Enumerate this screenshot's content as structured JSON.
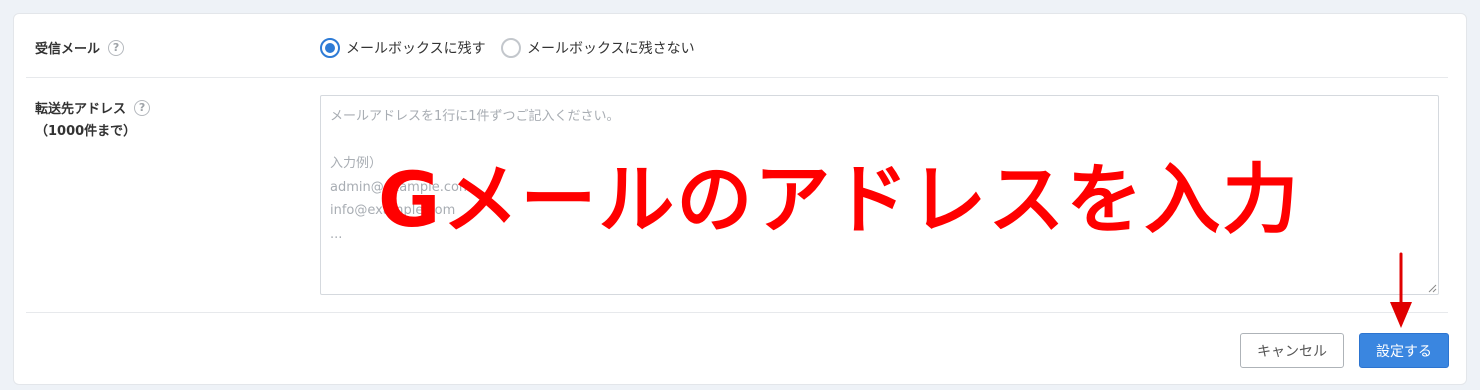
{
  "form": {
    "receive_mail": {
      "label": "受信メール",
      "help": "?",
      "options": [
        {
          "label": "メールボックスに残す",
          "selected": true
        },
        {
          "label": "メールボックスに残さない",
          "selected": false
        }
      ]
    },
    "forward_address": {
      "label": "転送先アドレス",
      "help": "?",
      "sublabel": "（1000件まで）",
      "placeholder": "メールアドレスを1行に1件ずつご記入ください。\n\n入力例）\nadmin@example.com\ninfo@example.com\n..."
    }
  },
  "footer": {
    "cancel_label": "キャンセル",
    "save_label": "設定する"
  },
  "annotation": {
    "text": "Gメールのアドレスを入力",
    "color": "#ff0000"
  },
  "colors": {
    "accent": "#3a86e0",
    "radio_selected": "#2e7bd6",
    "annotation": "#ff0000"
  }
}
